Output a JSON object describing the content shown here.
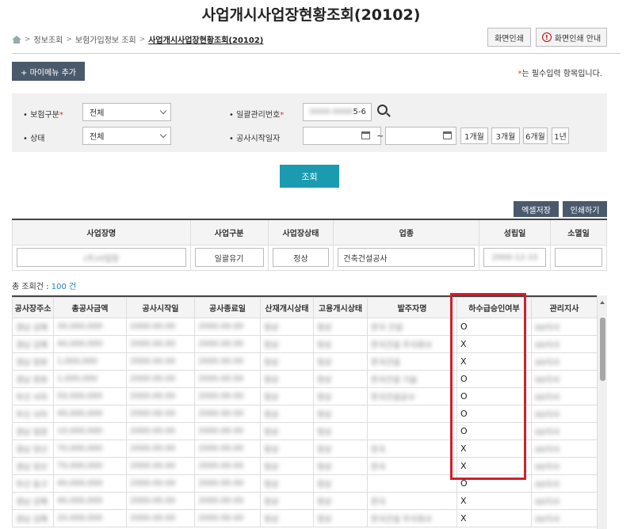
{
  "page_title": "사업개시사업장현황조회(20102)",
  "breadcrumb": [
    "정보조회",
    "보험가입정보 조회",
    "사업개시사업장현황조회(20102)"
  ],
  "top_buttons": {
    "print": "화면인쇄",
    "print_guide": "화면인쇄 안내"
  },
  "my_menu_label": "+ 마이메뉴 추가",
  "required_note": "는 필수입력 항목입니다.",
  "search": {
    "insurance_type_label": "보험구분",
    "insurance_type_value": "전체",
    "status_label": "상태",
    "status_value": "전체",
    "mgmt_no_label": "일괄관리번호",
    "mgmt_no_suffix": "5-6",
    "start_date_label": "공사시작일자",
    "range_sep": "~",
    "periods": [
      "1개월",
      "3개월",
      "6개월",
      "1년"
    ]
  },
  "query_button": "조회",
  "action_buttons": {
    "excel": "엑셀저장",
    "print": "인쇄하기"
  },
  "info_table": {
    "headers": [
      "사업장명",
      "사업구분",
      "사업장상태",
      "업종",
      "성립일",
      "소멸일"
    ],
    "values": [
      "(주)사업장",
      "일괄유기",
      "정상",
      "건축건설공사",
      "2000-12-10",
      ""
    ]
  },
  "total_label": "총 조회건 : ",
  "total_count": "100 건",
  "grid": {
    "headers": [
      "공사장주소",
      "총공사금액",
      "공사시작일",
      "공사종료일",
      "산재개시상태",
      "고용개시상태",
      "발주자명",
      "하수급승인여부",
      "관리지사"
    ],
    "rows": [
      [
        "경남 김해",
        "30,000,000",
        "2000.00.00",
        "2000.00.00",
        "정상",
        "정상",
        "한국 건설",
        "O",
        "00지사"
      ],
      [
        "경남 김해",
        "40,000,000",
        "2000.00.00",
        "2000.00.00",
        "정상",
        "정상",
        "한국건설 주식회사",
        "X",
        "00지사"
      ],
      [
        "경남 창원",
        "1,000,000",
        "2000.00.00",
        "2000.00.00",
        "정상",
        "정상",
        "한국건설",
        "X",
        "00지사"
      ],
      [
        "경남 창원",
        "1,000,000",
        "2000.00.00",
        "2000.00.00",
        "정상",
        "정상",
        "한국건설 기술",
        "O",
        "00지사"
      ],
      [
        "부산 사하",
        "50,000,000",
        "2000.00.00",
        "2000.00.00",
        "정상",
        "정상",
        "한국건설공사",
        "O",
        "00지사"
      ],
      [
        "부산 사하",
        "40,000,000",
        "2000.00.00",
        "2000.00.00",
        "정상",
        "정상",
        "",
        "O",
        "00지사"
      ],
      [
        "경남 밀양",
        "10,000,000",
        "2000.00.00",
        "2000.00.00",
        "정상",
        "정상",
        "",
        "O",
        "00지사"
      ],
      [
        "경남 양산",
        "70,000,000",
        "2000.00.00",
        "2000.00.00",
        "정상",
        "정상",
        "한국",
        "X",
        "00지사"
      ],
      [
        "경남 양산",
        "70,000,000",
        "2000.00.00",
        "2000.00.00",
        "정상",
        "정상",
        "한국",
        "X",
        "00지사"
      ],
      [
        "부산 동구",
        "40,000,000",
        "2000.00.00",
        "2000.00.00",
        "정상",
        "정상",
        "",
        "O",
        "00지사"
      ],
      [
        "경남 김해",
        "40,000,000",
        "2000.00.00",
        "2000.00.00",
        "정상",
        "정상",
        "한국",
        "X",
        "00지사"
      ],
      [
        "경남 김해",
        "20,000,000",
        "2000.00.00",
        "2000.00.00",
        "정상",
        "정상",
        "한국건설 주식회사",
        "X",
        "00지사"
      ]
    ]
  },
  "colors": {
    "highlight": "#d0202a",
    "primary_button": "#1a9bb0",
    "dark_button": "#4a5a6c"
  }
}
